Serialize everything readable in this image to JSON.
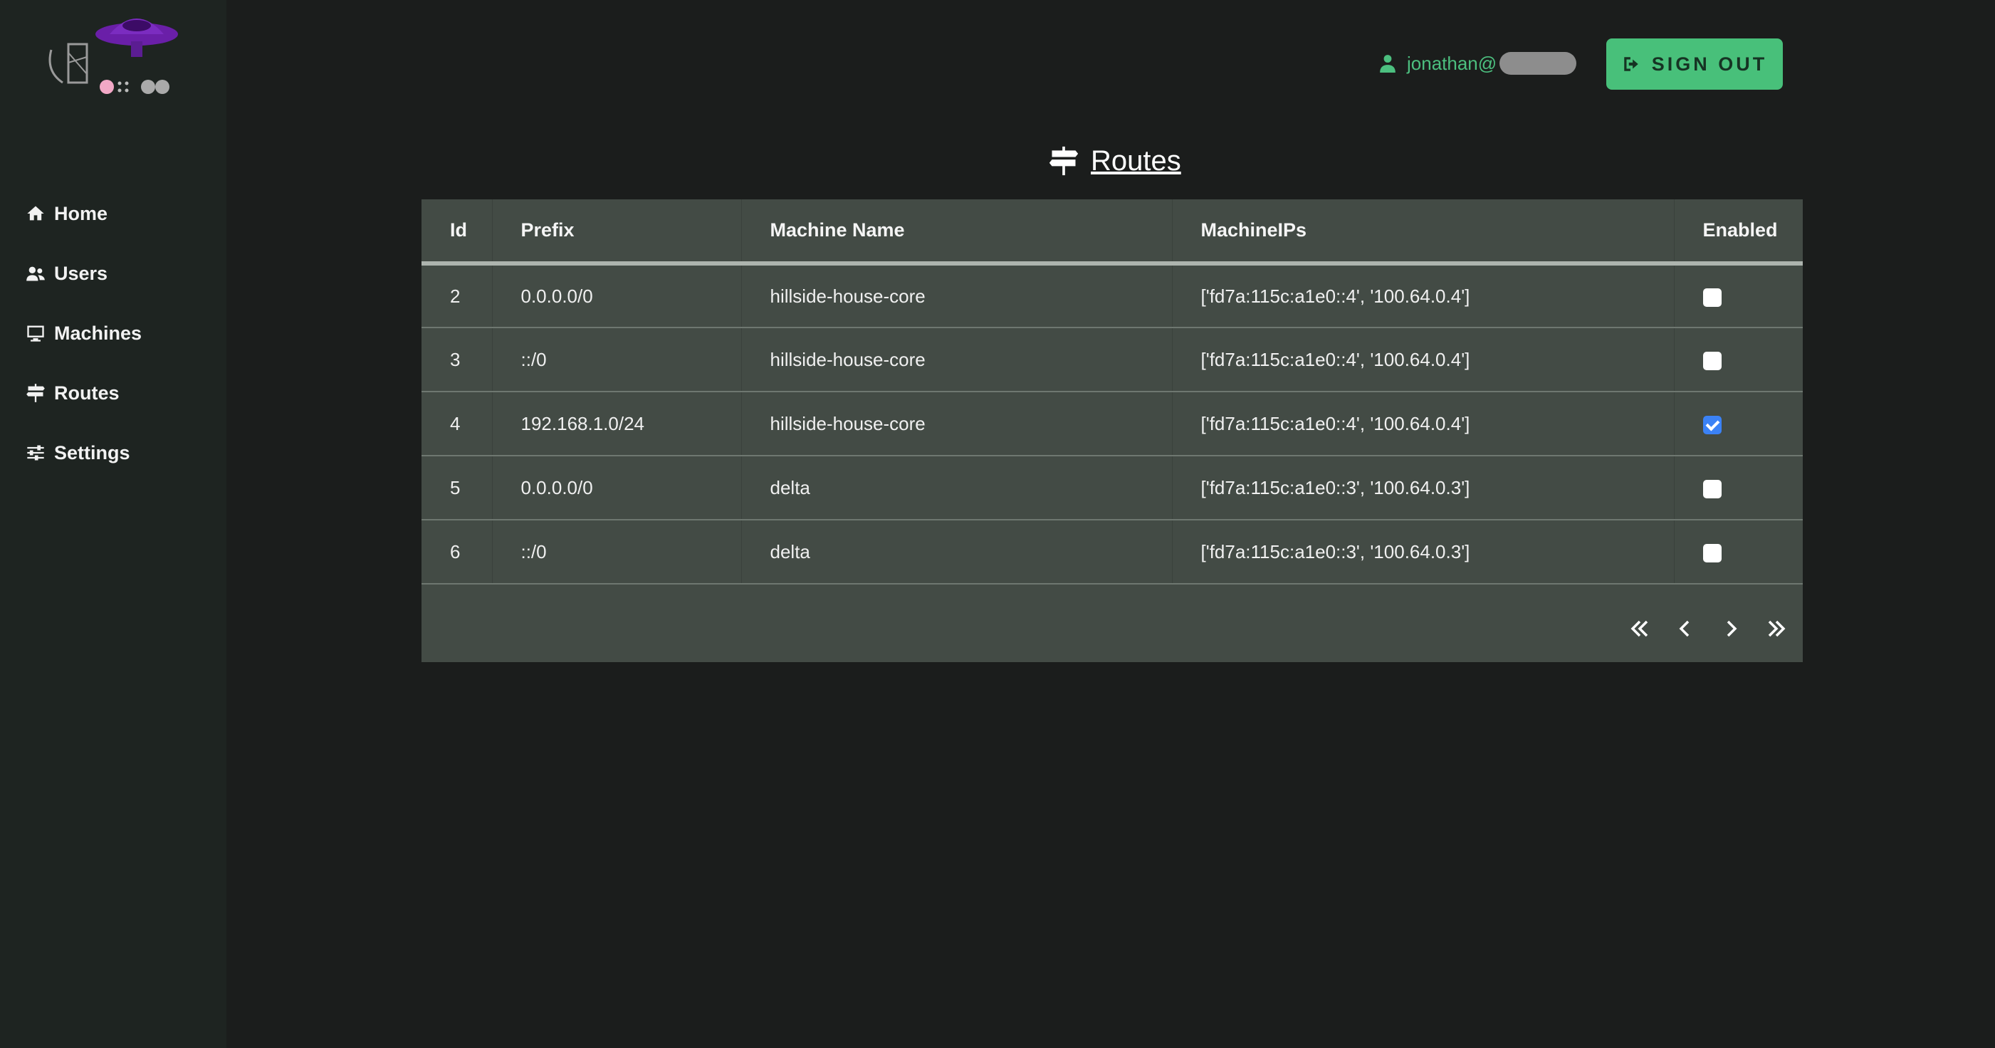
{
  "sidebar": {
    "items": [
      {
        "label": "Home",
        "icon": "home-icon"
      },
      {
        "label": "Users",
        "icon": "users-icon"
      },
      {
        "label": "Machines",
        "icon": "monitor-icon"
      },
      {
        "label": "Routes",
        "icon": "signpost-icon"
      },
      {
        "label": "Settings",
        "icon": "sliders-icon"
      }
    ]
  },
  "header": {
    "user": "jonathan@",
    "sign_out_label": "SIGN OUT"
  },
  "page": {
    "title": "Routes"
  },
  "table": {
    "columns": [
      "Id",
      "Prefix",
      "Machine Name",
      "MachineIPs",
      "Enabled"
    ],
    "rows": [
      {
        "id": "2",
        "prefix": "0.0.0.0/0",
        "machine": "hillside-house-core",
        "ips": "['fd7a:115c:a1e0::4', '100.64.0.4']",
        "enabled": false
      },
      {
        "id": "3",
        "prefix": "::/0",
        "machine": "hillside-house-core",
        "ips": "['fd7a:115c:a1e0::4', '100.64.0.4']",
        "enabled": false
      },
      {
        "id": "4",
        "prefix": "192.168.1.0/24",
        "machine": "hillside-house-core",
        "ips": "['fd7a:115c:a1e0::4', '100.64.0.4']",
        "enabled": true
      },
      {
        "id": "5",
        "prefix": "0.0.0.0/0",
        "machine": "delta",
        "ips": "['fd7a:115c:a1e0::3', '100.64.0.3']",
        "enabled": false
      },
      {
        "id": "6",
        "prefix": "::/0",
        "machine": "delta",
        "ips": "['fd7a:115c:a1e0::3', '100.64.0.3']",
        "enabled": false
      }
    ]
  },
  "pagination": [
    "first-page-icon",
    "prev-page-icon",
    "next-page-icon",
    "last-page-icon"
  ],
  "colors": {
    "accent": "#48c07a",
    "background": "#1b1d1c",
    "sidebar": "#1e2421",
    "table": "#434b45",
    "checkbox_checked": "#3b82f6"
  }
}
